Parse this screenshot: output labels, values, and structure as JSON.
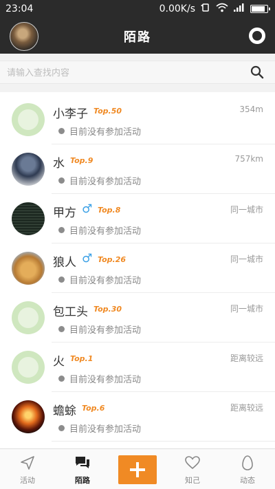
{
  "status_bar": {
    "time": "23:04",
    "network_speed": "0.00K/s",
    "battery_level": 0.9
  },
  "header": {
    "title": "陌路"
  },
  "search": {
    "placeholder": "请输入查找内容"
  },
  "users": [
    {
      "name": "小李子",
      "gender": "",
      "rank": "Top.50",
      "distance": "354m",
      "status": "目前没有参加活动",
      "avatar": "default"
    },
    {
      "name": "水",
      "gender": "",
      "rank": "Top.9",
      "distance": "757km",
      "status": "目前没有参加活动",
      "avatar": "photo-blue"
    },
    {
      "name": "甲方",
      "gender": "♂",
      "rank": "Top.8",
      "distance": "同一城市",
      "status": "目前没有参加活动",
      "avatar": "photo-dark"
    },
    {
      "name": "狼人",
      "gender": "♂",
      "rank": "Top.26",
      "distance": "同一城市",
      "status": "目前没有参加活动",
      "avatar": "photo-dog"
    },
    {
      "name": "包工头",
      "gender": "",
      "rank": "Top.30",
      "distance": "同一城市",
      "status": "目前没有参加活动",
      "avatar": "default"
    },
    {
      "name": "火",
      "gender": "",
      "rank": "Top.1",
      "distance": "距离较远",
      "status": "目前没有参加活动",
      "avatar": "default"
    },
    {
      "name": "蟾蜍",
      "gender": "",
      "rank": "Top.6",
      "distance": "距离较远",
      "status": "目前没有参加活动",
      "avatar": "photo-fire"
    }
  ],
  "tabs": [
    {
      "label": "活动",
      "icon": "send-icon",
      "active": false
    },
    {
      "label": "陌路",
      "icon": "chat-icon",
      "active": true
    },
    {
      "label": "",
      "icon": "plus-icon",
      "active": false
    },
    {
      "label": "知己",
      "icon": "heart-icon",
      "active": false
    },
    {
      "label": "动态",
      "icon": "egg-icon",
      "active": false
    }
  ],
  "colors": {
    "bar_dark": "#2b2b2b",
    "accent_orange": "#f08a24",
    "male_blue": "#3aa0e6"
  }
}
